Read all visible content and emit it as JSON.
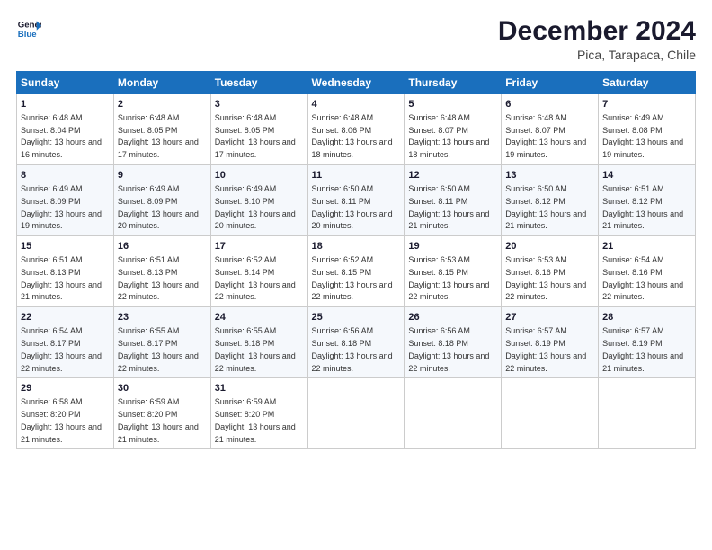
{
  "logo": {
    "line1": "General",
    "line2": "Blue"
  },
  "title": "December 2024",
  "subtitle": "Pica, Tarapaca, Chile",
  "weekdays": [
    "Sunday",
    "Monday",
    "Tuesday",
    "Wednesday",
    "Thursday",
    "Friday",
    "Saturday"
  ],
  "weeks": [
    [
      {
        "day": "1",
        "sunrise": "6:48 AM",
        "sunset": "8:04 PM",
        "daylight": "13 hours and 16 minutes."
      },
      {
        "day": "2",
        "sunrise": "6:48 AM",
        "sunset": "8:05 PM",
        "daylight": "13 hours and 17 minutes."
      },
      {
        "day": "3",
        "sunrise": "6:48 AM",
        "sunset": "8:05 PM",
        "daylight": "13 hours and 17 minutes."
      },
      {
        "day": "4",
        "sunrise": "6:48 AM",
        "sunset": "8:06 PM",
        "daylight": "13 hours and 18 minutes."
      },
      {
        "day": "5",
        "sunrise": "6:48 AM",
        "sunset": "8:07 PM",
        "daylight": "13 hours and 18 minutes."
      },
      {
        "day": "6",
        "sunrise": "6:48 AM",
        "sunset": "8:07 PM",
        "daylight": "13 hours and 19 minutes."
      },
      {
        "day": "7",
        "sunrise": "6:49 AM",
        "sunset": "8:08 PM",
        "daylight": "13 hours and 19 minutes."
      }
    ],
    [
      {
        "day": "8",
        "sunrise": "6:49 AM",
        "sunset": "8:09 PM",
        "daylight": "13 hours and 19 minutes."
      },
      {
        "day": "9",
        "sunrise": "6:49 AM",
        "sunset": "8:09 PM",
        "daylight": "13 hours and 20 minutes."
      },
      {
        "day": "10",
        "sunrise": "6:49 AM",
        "sunset": "8:10 PM",
        "daylight": "13 hours and 20 minutes."
      },
      {
        "day": "11",
        "sunrise": "6:50 AM",
        "sunset": "8:11 PM",
        "daylight": "13 hours and 20 minutes."
      },
      {
        "day": "12",
        "sunrise": "6:50 AM",
        "sunset": "8:11 PM",
        "daylight": "13 hours and 21 minutes."
      },
      {
        "day": "13",
        "sunrise": "6:50 AM",
        "sunset": "8:12 PM",
        "daylight": "13 hours and 21 minutes."
      },
      {
        "day": "14",
        "sunrise": "6:51 AM",
        "sunset": "8:12 PM",
        "daylight": "13 hours and 21 minutes."
      }
    ],
    [
      {
        "day": "15",
        "sunrise": "6:51 AM",
        "sunset": "8:13 PM",
        "daylight": "13 hours and 21 minutes."
      },
      {
        "day": "16",
        "sunrise": "6:51 AM",
        "sunset": "8:13 PM",
        "daylight": "13 hours and 22 minutes."
      },
      {
        "day": "17",
        "sunrise": "6:52 AM",
        "sunset": "8:14 PM",
        "daylight": "13 hours and 22 minutes."
      },
      {
        "day": "18",
        "sunrise": "6:52 AM",
        "sunset": "8:15 PM",
        "daylight": "13 hours and 22 minutes."
      },
      {
        "day": "19",
        "sunrise": "6:53 AM",
        "sunset": "8:15 PM",
        "daylight": "13 hours and 22 minutes."
      },
      {
        "day": "20",
        "sunrise": "6:53 AM",
        "sunset": "8:16 PM",
        "daylight": "13 hours and 22 minutes."
      },
      {
        "day": "21",
        "sunrise": "6:54 AM",
        "sunset": "8:16 PM",
        "daylight": "13 hours and 22 minutes."
      }
    ],
    [
      {
        "day": "22",
        "sunrise": "6:54 AM",
        "sunset": "8:17 PM",
        "daylight": "13 hours and 22 minutes."
      },
      {
        "day": "23",
        "sunrise": "6:55 AM",
        "sunset": "8:17 PM",
        "daylight": "13 hours and 22 minutes."
      },
      {
        "day": "24",
        "sunrise": "6:55 AM",
        "sunset": "8:18 PM",
        "daylight": "13 hours and 22 minutes."
      },
      {
        "day": "25",
        "sunrise": "6:56 AM",
        "sunset": "8:18 PM",
        "daylight": "13 hours and 22 minutes."
      },
      {
        "day": "26",
        "sunrise": "6:56 AM",
        "sunset": "8:18 PM",
        "daylight": "13 hours and 22 minutes."
      },
      {
        "day": "27",
        "sunrise": "6:57 AM",
        "sunset": "8:19 PM",
        "daylight": "13 hours and 22 minutes."
      },
      {
        "day": "28",
        "sunrise": "6:57 AM",
        "sunset": "8:19 PM",
        "daylight": "13 hours and 21 minutes."
      }
    ],
    [
      {
        "day": "29",
        "sunrise": "6:58 AM",
        "sunset": "8:20 PM",
        "daylight": "13 hours and 21 minutes."
      },
      {
        "day": "30",
        "sunrise": "6:59 AM",
        "sunset": "8:20 PM",
        "daylight": "13 hours and 21 minutes."
      },
      {
        "day": "31",
        "sunrise": "6:59 AM",
        "sunset": "8:20 PM",
        "daylight": "13 hours and 21 minutes."
      },
      null,
      null,
      null,
      null
    ]
  ],
  "labels": {
    "sunrise_prefix": "Sunrise: ",
    "sunset_prefix": "Sunset: ",
    "daylight_prefix": "Daylight: "
  }
}
